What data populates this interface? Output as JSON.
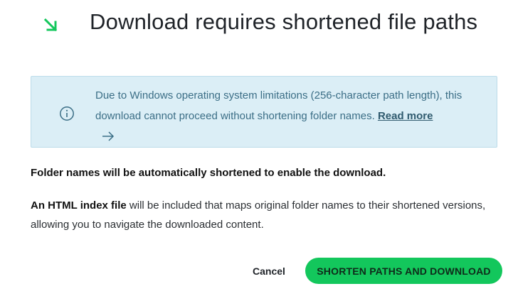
{
  "dialog": {
    "title": "Download requires shortened file paths",
    "header_icon": "arrow-down-right-icon",
    "accent_color": "#13c75c"
  },
  "info": {
    "icon": "info-icon",
    "text": "Due to Windows operating system limitations (256-character path length), this download cannot proceed without shortening folder names.",
    "read_more_label": "Read more",
    "arrow_icon": "arrow-right-icon",
    "background_color": "#dbeef6"
  },
  "body": {
    "notice": "Folder names will be automatically shortened to enable the download.",
    "index_bold": "An HTML index file",
    "index_rest": "will be included that maps original folder names to their shortened versions, allowing you to navigate the downloaded content."
  },
  "actions": {
    "cancel_label": "Cancel",
    "confirm_label": "SHORTEN PATHS AND DOWNLOAD"
  }
}
